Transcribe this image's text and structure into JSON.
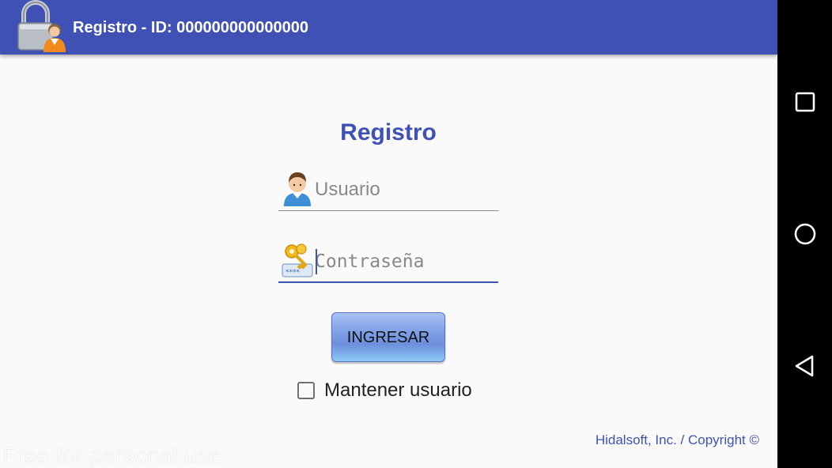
{
  "app_bar": {
    "title": "Registro - ID: 000000000000000",
    "logo_icon": "lock-user-icon",
    "background": "#3f51b5"
  },
  "form": {
    "title": "Registro",
    "username": {
      "icon": "user-avatar-icon",
      "value": "",
      "placeholder": "Usuario"
    },
    "password": {
      "icon": "keys-password-icon",
      "value": "",
      "placeholder": "Contraseña"
    },
    "login_button_label": "INGRESAR",
    "keep_user": {
      "label": "Mantener usuario",
      "checked": false
    },
    "accent_color": "#3f51b5"
  },
  "footer": {
    "copyright": "Hidalsoft, Inc. / Copyright ©",
    "watermark": "Free for personal use"
  },
  "nav_bar": {
    "buttons": [
      "recents-icon",
      "home-icon",
      "back-icon"
    ]
  }
}
